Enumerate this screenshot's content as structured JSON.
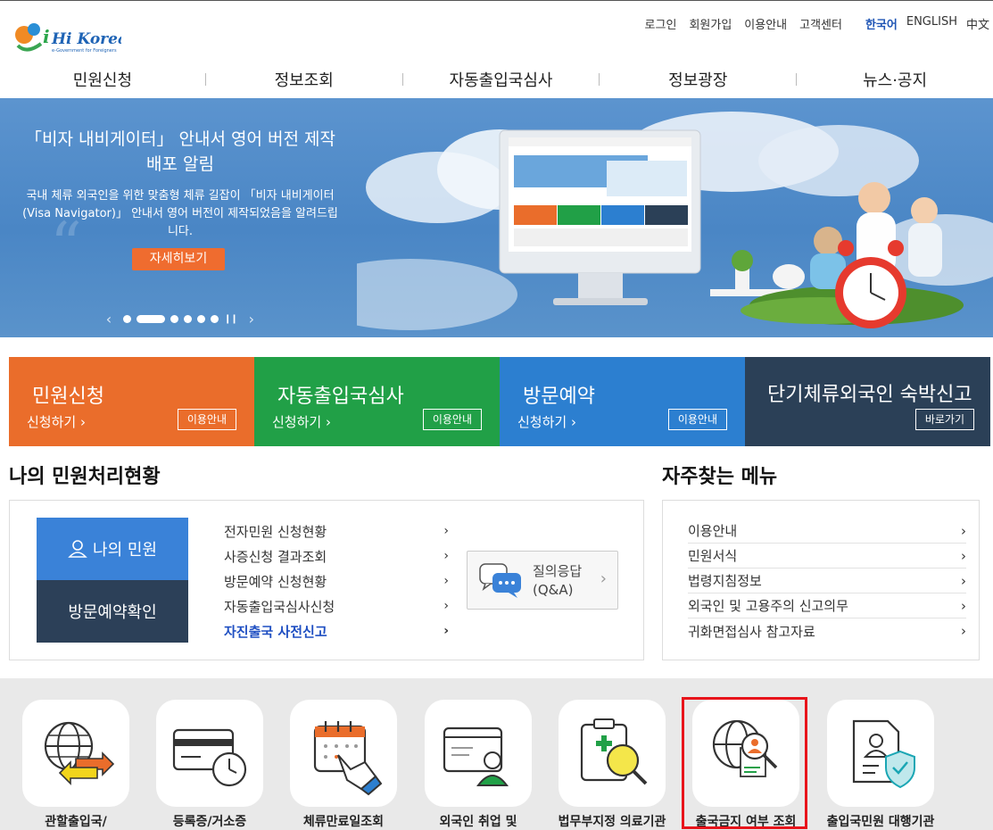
{
  "header": {
    "logo_text": "Hi Korea",
    "logo_tagline": "e-Government for Foreigners",
    "util": [
      "로그인",
      "회원가입",
      "이용안내",
      "고객센터"
    ],
    "langs": {
      "active": "한국어",
      "en": "ENGLISH",
      "zh": "中文"
    },
    "gnb": [
      "민원신청",
      "정보조회",
      "자동출입국심사",
      "정보광장",
      "뉴스·공지"
    ]
  },
  "hero": {
    "title": "「비자 내비게이터」 안내서 영어 버전 제작배포 알림",
    "desc": "국내 체류 외국인을 위한 맞춤형 체류 길잡이 「비자 내비게이터(Visa Navigator)」 안내서 영어 버전이 제작되었음을 알려드립니다.",
    "button": "자세히보기",
    "slide_count": 7,
    "active_slide": 2
  },
  "tiles": [
    {
      "title": "민원신청",
      "sub": "신청하기",
      "btn": "이용안내",
      "color": "#ea6d2b"
    },
    {
      "title": "자동출입국심사",
      "sub": "신청하기",
      "btn": "이용안내",
      "color": "#21a047"
    },
    {
      "title": "방문예약",
      "sub": "신청하기",
      "btn": "이용안내",
      "color": "#2c7fd0"
    },
    {
      "title": "단기체류외국인 숙박신고",
      "sub": "",
      "btn": "바로가기",
      "color": "#2b4057"
    }
  ],
  "my_status": {
    "title": "나의 민원처리현황",
    "my_button": "나의 민원",
    "visit_button": "방문예약확인",
    "links": [
      "전자민원 신청현황",
      "사증신청 결과조회",
      "방문예약 신청현황",
      "자동출입국심사신청",
      "자진출국 사전신고"
    ],
    "qa_label_1": "질의응답",
    "qa_label_2": "(Q&A)"
  },
  "favorites": {
    "title": "자주찾는 메뉴",
    "links": [
      "이용안내",
      "민원서식",
      "법령지침정보",
      "외국인 및 고용주의 신고의무",
      "귀화면접심사 참고자료"
    ]
  },
  "quick_menu": [
    "관할출입국/",
    "등록증/거소증",
    "체류만료일조회",
    "외국인 취업 및",
    "법무부지정 의료기관",
    "출국금지 여부 조회",
    "출입국민원 대행기관"
  ],
  "colors": {
    "highlight": "#e8141b",
    "accent": "#1f55b5"
  }
}
